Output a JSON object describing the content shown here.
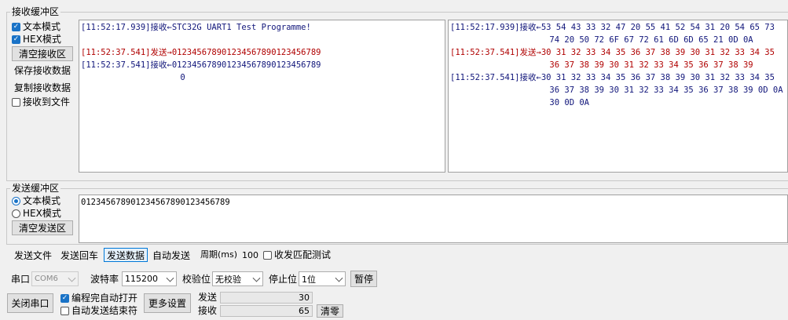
{
  "receive": {
    "title": "接收缓冲区",
    "text_mode": "文本模式",
    "hex_mode": "HEX模式",
    "clear_btn": "清空接收区",
    "save_btn": "保存接收数据",
    "copy_btn": "复制接收数据",
    "to_file": "接收到文件",
    "text_lines": [
      {
        "text": "[11:52:17.939]接收←STC32G UART1 Test Programme!",
        "color": "blue"
      },
      {
        "text": "",
        "color": "blue"
      },
      {
        "text": "[11:52:37.541]发送→012345678901234567890123456789",
        "color": "red"
      },
      {
        "text": "[11:52:37.541]接收←012345678901234567890123456789",
        "color": "blue"
      },
      {
        "text": "                    0",
        "color": "blue"
      }
    ],
    "hex_lines": [
      {
        "text": "[11:52:17.939]接收←53 54 43 33 32 47 20 55 41 52 54 31 20 54 65 73",
        "color": "blue"
      },
      {
        "text": "                    74 20 50 72 6F 67 72 61 6D 6D 65 21 0D 0A",
        "color": "blue"
      },
      {
        "text": "[11:52:37.541]发送→30 31 32 33 34 35 36 37 38 39 30 31 32 33 34 35",
        "color": "red"
      },
      {
        "text": "                    36 37 38 39 30 31 32 33 34 35 36 37 38 39",
        "color": "red"
      },
      {
        "text": "[11:52:37.541]接收←30 31 32 33 34 35 36 37 38 39 30 31 32 33 34 35",
        "color": "blue"
      },
      {
        "text": "                    36 37 38 39 30 31 32 33 34 35 36 37 38 39 0D 0A",
        "color": "blue"
      },
      {
        "text": "                    30 0D 0A",
        "color": "blue"
      }
    ]
  },
  "send": {
    "title": "发送缓冲区",
    "text_mode": "文本模式",
    "hex_mode": "HEX模式",
    "clear_btn": "清空发送区",
    "content": "012345678901234567890123456789"
  },
  "send_buttons": {
    "send_file": "发送文件",
    "send_enter": "发送回车",
    "send_data": "发送数据",
    "auto_send": "自动发送",
    "period_label": "周期(ms)",
    "period_value": "100",
    "match_test": "收发匹配测试"
  },
  "port": {
    "port_label": "串口",
    "port_value": "COM6",
    "baud_label": "波特率",
    "baud_value": "115200",
    "parity_label": "校验位",
    "parity_value": "无校验",
    "stop_label": "停止位",
    "stop_value": "1位",
    "pause_btn": "暂停",
    "close_btn": "关闭串口",
    "auto_open": "编程完自动打开",
    "auto_send_end": "自动发送结束符",
    "more_btn": "更多设置",
    "sent_label": "发送",
    "sent_count": "30",
    "recv_label": "接收",
    "recv_count": "65",
    "clear_count_btn": "清零"
  }
}
